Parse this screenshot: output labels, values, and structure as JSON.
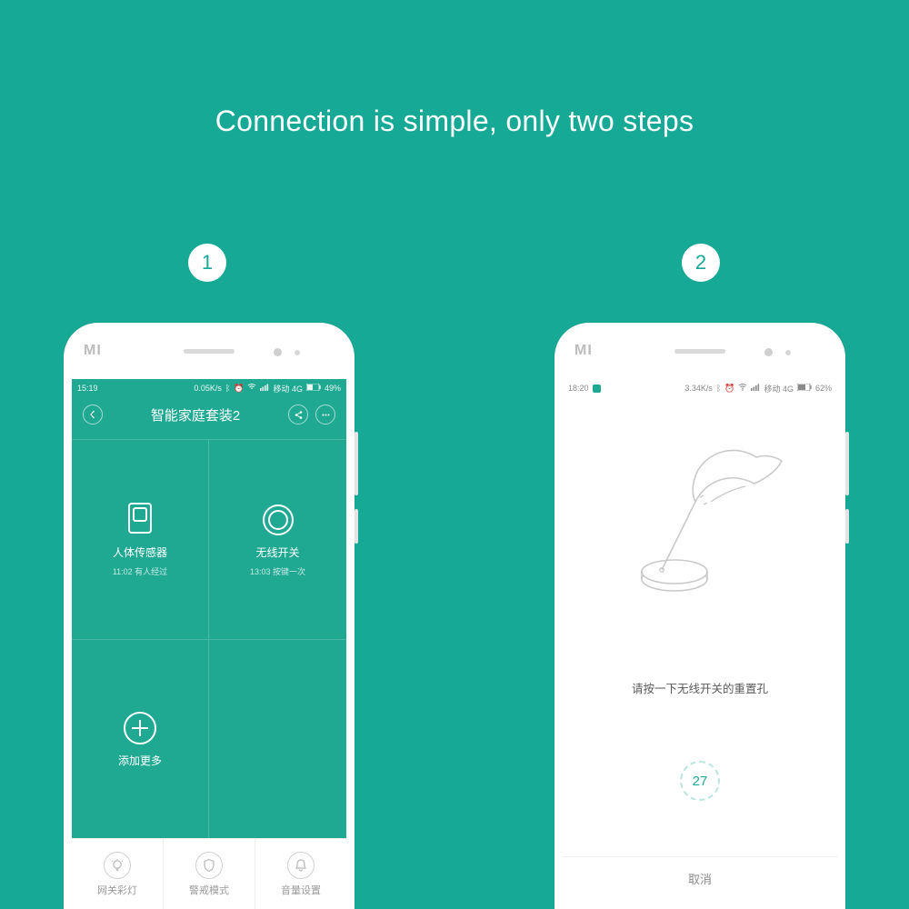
{
  "headline": "Connection is simple, only two steps",
  "steps": {
    "one": "1",
    "two": "2"
  },
  "brand": "MI",
  "phone1": {
    "statusbar": {
      "time": "15:19",
      "speed": "0.05K/s",
      "network": "移动 4G",
      "battery": "49%"
    },
    "title": "智能家庭套装2",
    "grid": {
      "sensor": {
        "label": "人体传感器",
        "sub": "11:02 有人经过"
      },
      "switch": {
        "label": "无线开关",
        "sub": "13:03 按键一次"
      },
      "add": {
        "label": "添加更多"
      }
    },
    "tabs": {
      "light": "网关彩灯",
      "alarm": "警戒模式",
      "volume": "音量设置"
    }
  },
  "phone2": {
    "statusbar": {
      "time": "18:20",
      "speed": "3.34K/s",
      "network": "移动 4G",
      "battery": "62%"
    },
    "instruction": "请按一下无线开关的重置孔",
    "countdown": "27",
    "cancel": "取消"
  }
}
